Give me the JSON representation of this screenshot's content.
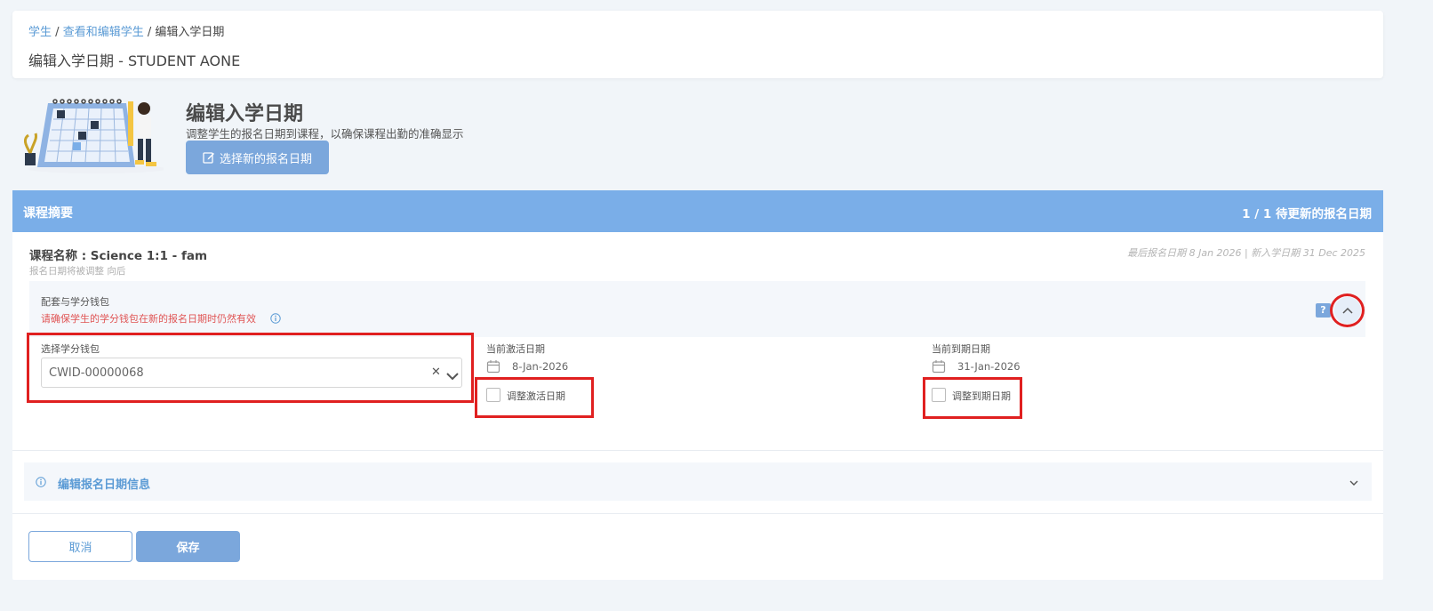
{
  "breadcrumb": {
    "item1": "学生",
    "sep1": "/",
    "item2": "查看和编辑学生",
    "sep2": "/",
    "current": "编辑入学日期"
  },
  "page_title": "编辑入学日期 - STUDENT AONE",
  "hero": {
    "title": "编辑入学日期",
    "subtitle": "调整学生的报名日期到课程，以确保课程出勤的准确显示",
    "button_label": "选择新的报名日期"
  },
  "summary": {
    "title": "课程摘要",
    "count": "1 / 1 待更新的报名日期"
  },
  "course": {
    "name": "课程名称 : Science 1:1 - fam",
    "adjust_note": "报名日期将被调整 向后",
    "dates_meta": "最后报名日期 8 Jan 2026 | 新入学日期 31 Dec 2025"
  },
  "package": {
    "heading": "配套与学分钱包",
    "warning": "请确保学生的学分钱包在新的报名日期时仍然有效",
    "help_label": "?"
  },
  "wallet": {
    "label": "选择学分钱包",
    "value": "CWID-00000068",
    "clear_glyph": "✕"
  },
  "activation": {
    "label": "当前激活日期",
    "value": "8-Jan-2026",
    "checkbox_label": "调整激活日期"
  },
  "expiry": {
    "label": "当前到期日期",
    "value": "31-Jan-2026",
    "checkbox_label": "调整到期日期"
  },
  "edit_info": {
    "label": "编辑报名日期信息"
  },
  "actions": {
    "cancel": "取消",
    "save": "保存"
  },
  "colors": {
    "accent": "#7aaee8",
    "accent_button": "#7ba7dc",
    "link": "#5b9bd5",
    "warning": "#e05555",
    "highlight": "#e02020"
  }
}
